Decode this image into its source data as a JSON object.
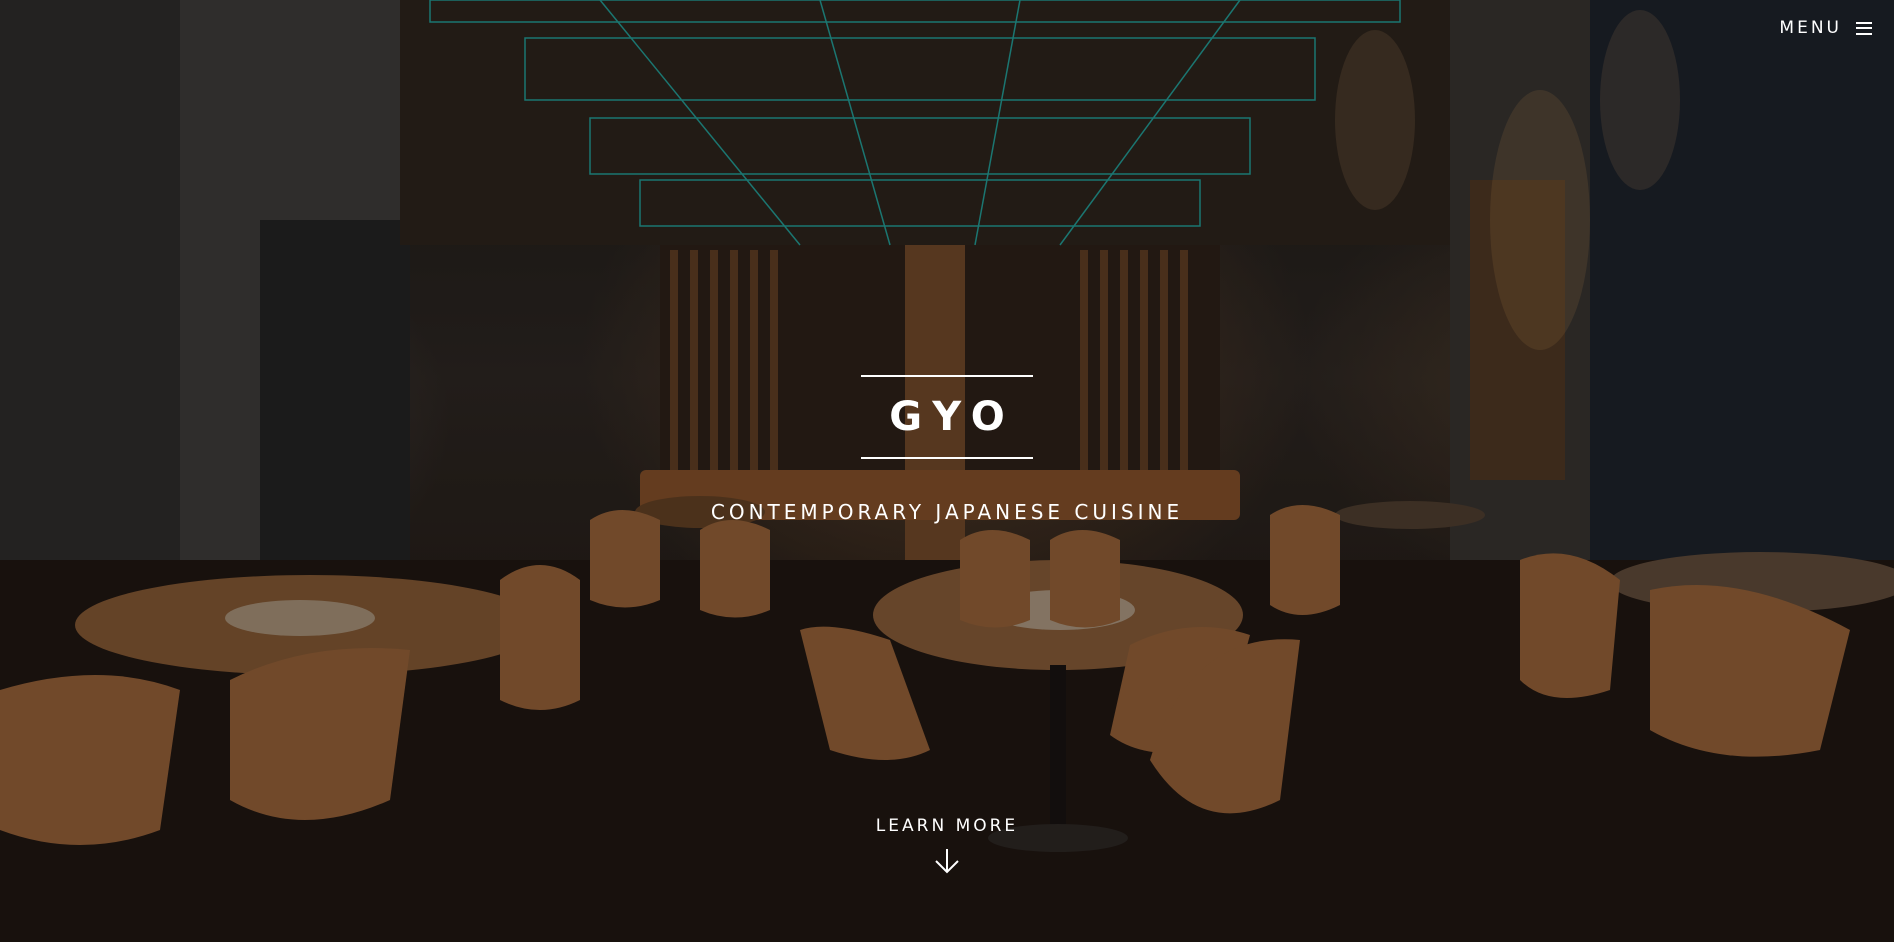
{
  "header": {
    "menu_label": "MENU",
    "menu_icon": "hamburger-icon"
  },
  "hero": {
    "title": "GYO",
    "tagline": "CONTEMPORARY JAPANESE CUISINE",
    "cta_label": "LEARN MORE",
    "cta_icon": "arrow-down-icon",
    "background_image": "dark restaurant dining room with wooden tables, leather chairs and teal-lit ceiling grid"
  },
  "colors": {
    "text": "#ffffff",
    "ceiling_accent": "#1fb6b0",
    "wood": "#7a4e2c",
    "chair": "#8a5a34"
  }
}
